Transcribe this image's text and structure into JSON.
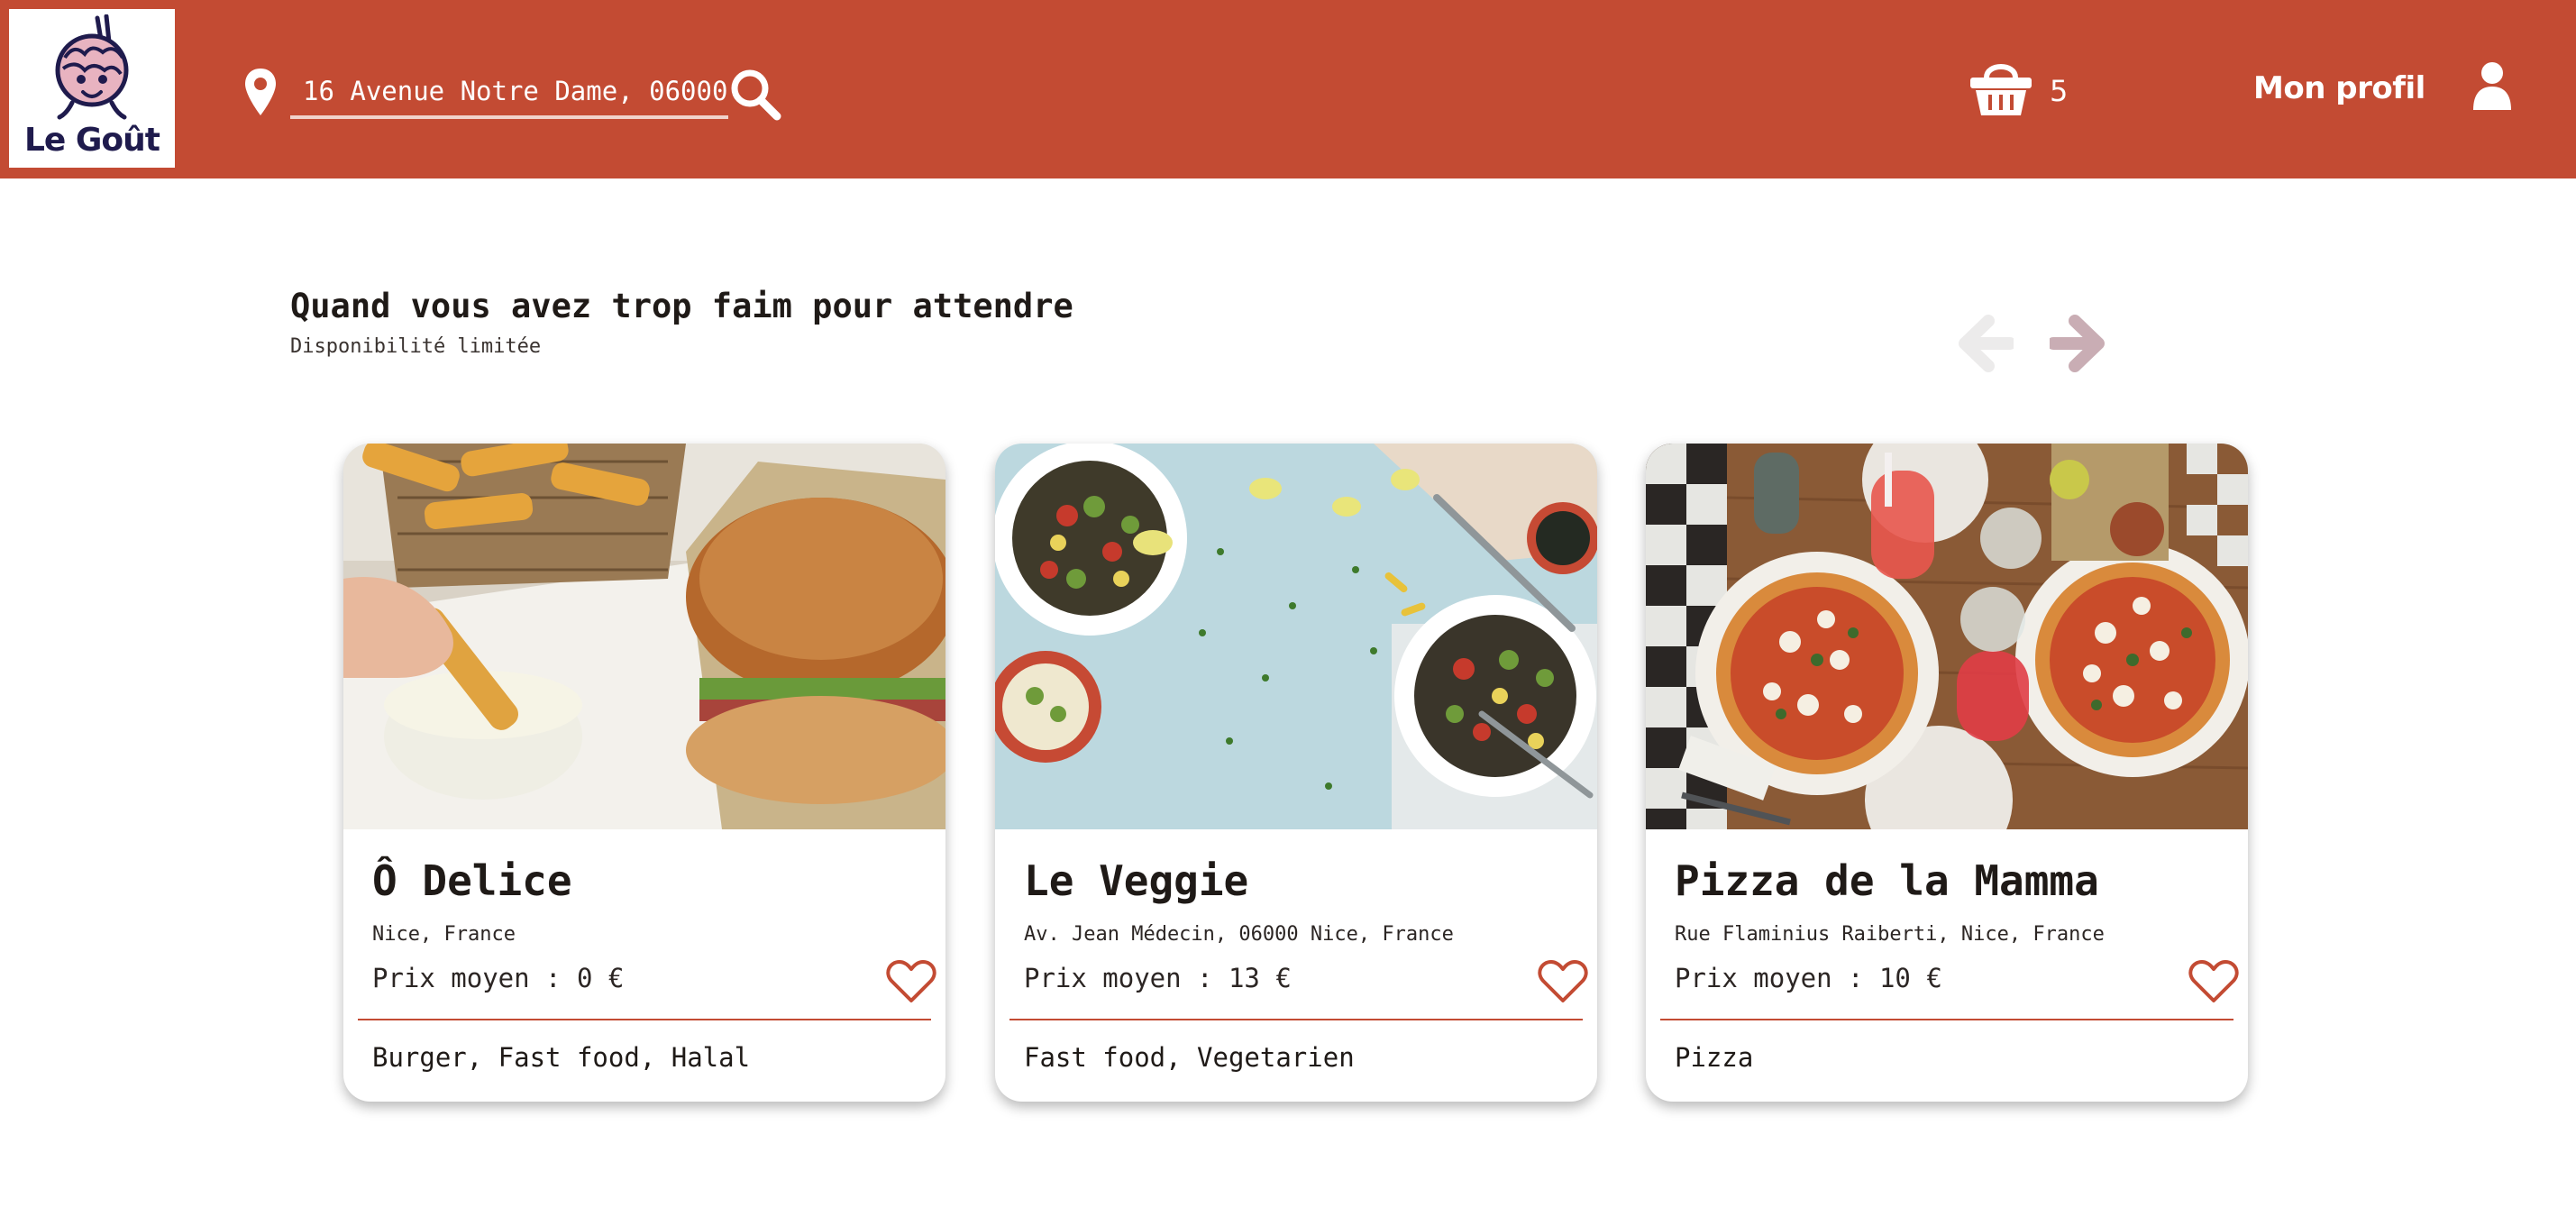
{
  "brand": {
    "name": "Le Goût"
  },
  "header": {
    "address_value": "16 Avenue Notre Dame, 06000",
    "cart_count": "5",
    "profile_label": "Mon profil"
  },
  "section": {
    "title": "Quand vous avez trop faim pour attendre",
    "subtitle": "Disponibilité limitée"
  },
  "restaurants": [
    {
      "name": "Ô Delice",
      "address": "Nice, France",
      "price": "Prix moyen : 0 €",
      "tags": "Burger, Fast food, Halal",
      "photo": "burger-fries-photo"
    },
    {
      "name": "Le Veggie",
      "address": "Av. Jean Médecin, 06000 Nice, France",
      "price": "Prix moyen : 13 €",
      "tags": "Fast food, Vegetarien",
      "photo": "salad-bowls-photo"
    },
    {
      "name": "Pizza de la Mamma",
      "address": "Rue Flaminius Raiberti, Nice, France",
      "price": "Prix moyen : 10 €",
      "tags": "Pizza",
      "photo": "pizzas-table-photo"
    }
  ],
  "colors": {
    "accent": "#c34b33",
    "arrow_active": "#c9adb4",
    "arrow_disabled": "#ecebeb",
    "logo_text": "#1f1b4d"
  },
  "icons": [
    "location-pin-icon",
    "search-icon",
    "basket-icon",
    "user-icon",
    "arrow-left-icon",
    "arrow-right-icon",
    "heart-icon"
  ]
}
